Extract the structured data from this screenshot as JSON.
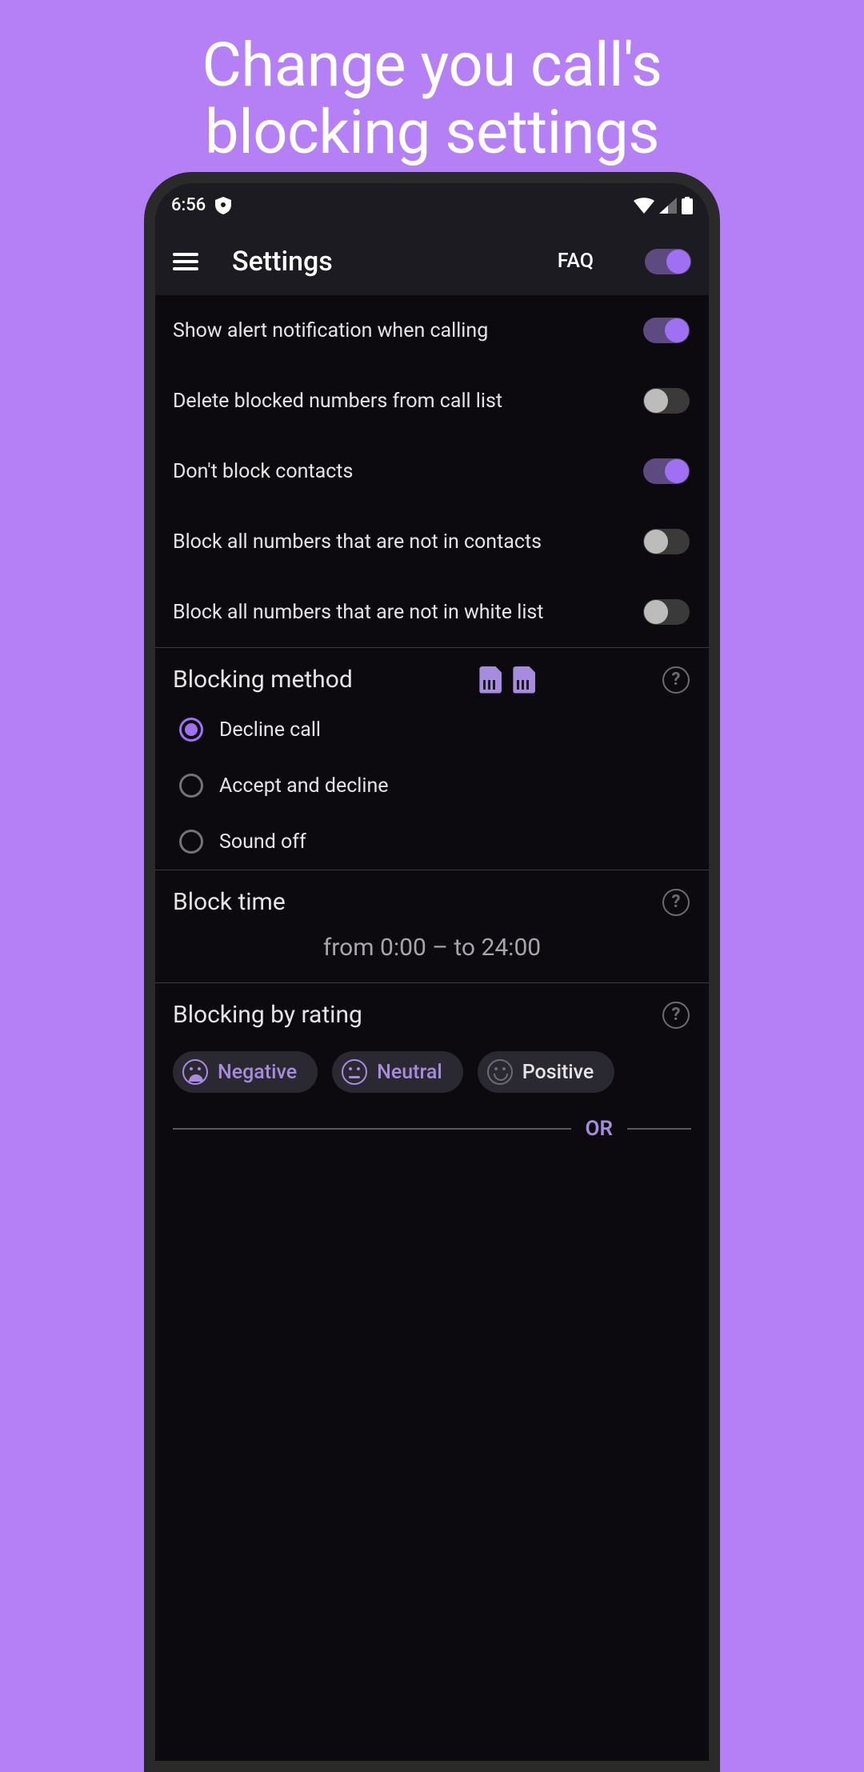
{
  "hero": {
    "line1": "Change you call's",
    "line2": "blocking settings"
  },
  "status": {
    "time": "6:56"
  },
  "appbar": {
    "title": "Settings",
    "faq": "FAQ",
    "master_toggle": true
  },
  "settings": [
    {
      "label": "Show alert notification when calling",
      "on": true
    },
    {
      "label": "Delete blocked numbers from call list",
      "on": false
    },
    {
      "label": "Don't block contacts",
      "on": true
    },
    {
      "label": "Block all numbers that are not in contacts",
      "on": false
    },
    {
      "label": "Block all numbers that are not in white list",
      "on": false
    }
  ],
  "blocking_method": {
    "title": "Blocking method",
    "options": [
      {
        "label": "Decline call",
        "selected": true
      },
      {
        "label": "Accept and decline",
        "selected": false
      },
      {
        "label": "Sound off",
        "selected": false
      }
    ]
  },
  "block_time": {
    "title": "Block time",
    "value": "from 0:00 – to 24:00"
  },
  "rating": {
    "title": "Blocking by rating",
    "chips": [
      {
        "label": "Negative",
        "mood": "sad",
        "active": true
      },
      {
        "label": "Neutral",
        "mood": "neutral",
        "active": true
      },
      {
        "label": "Positive",
        "mood": "happy",
        "active": false
      }
    ],
    "or": "OR"
  }
}
